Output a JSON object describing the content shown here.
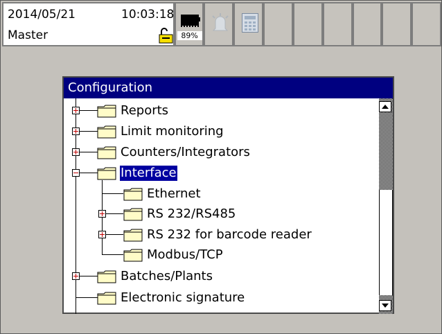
{
  "status_bar": {
    "date": "2014/05/21",
    "time": "10:03:18",
    "user": "Master",
    "battery_percent": "89%"
  },
  "dialog": {
    "title": "Configuration",
    "tree": [
      {
        "label": "Reports",
        "expander": "plus",
        "selected": false
      },
      {
        "label": "Limit monitoring",
        "expander": "plus",
        "selected": false
      },
      {
        "label": "Counters/Integrators",
        "expander": "plus",
        "selected": false
      },
      {
        "label": "Interface",
        "expander": "minus",
        "selected": true
      },
      {
        "label": "Ethernet",
        "expander": "none",
        "selected": false
      },
      {
        "label": "RS 232/RS485",
        "expander": "plus",
        "selected": false
      },
      {
        "label": "RS 232 for barcode reader",
        "expander": "plus",
        "selected": false
      },
      {
        "label": "Modbus/TCP",
        "expander": "none",
        "selected": false
      },
      {
        "label": "Batches/Plants",
        "expander": "plus",
        "selected": false
      },
      {
        "label": "Electronic signature",
        "expander": "none",
        "selected": false
      }
    ]
  },
  "colors": {
    "title_bar": "#000080",
    "selection": "#0000a0",
    "background": "#c4c1bb",
    "folder": "#fffcc8"
  }
}
